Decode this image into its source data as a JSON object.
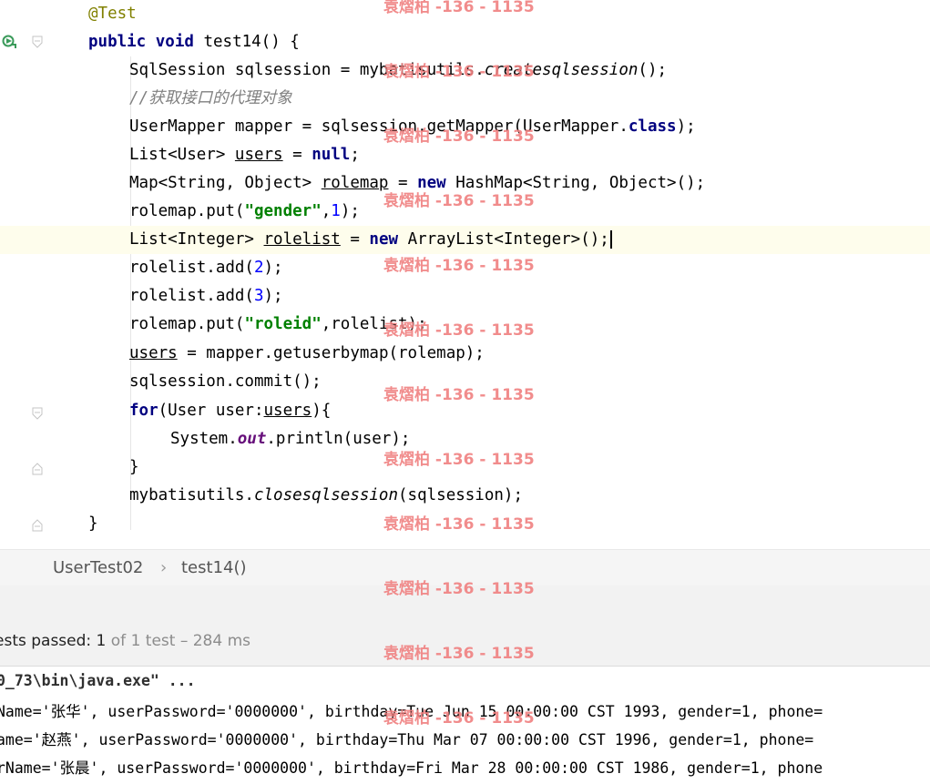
{
  "editor": {
    "lines": [
      {
        "id": "l0"
      },
      {
        "id": "l1"
      }
    ],
    "code": {
      "ann": "@Test",
      "public": "public",
      "void": "void",
      "method_sig": " test14() {",
      "l2_a": "SqlSession sqlsession = mybatisutils.",
      "l2_b": "createsqlsession",
      "l2_c": "();",
      "l3": "//获取接口的代理对象",
      "l4_a": "UserMapper mapper = sqlsession.getMapper(UserMapper.",
      "l4_class": "class",
      "l4_b": ");",
      "l5_a": "List<User> ",
      "l5_users": "users",
      "l5_b": " = ",
      "l5_null": "null",
      "l5_c": ";",
      "l6_a": "Map<String, Object> ",
      "l6_rolemap": "rolemap",
      "l6_b": " = ",
      "l6_new": "new",
      "l6_c": " HashMap<String, Object>();",
      "l7_a": "rolemap.put(",
      "l7_str": "\"gender\"",
      "l7_b": ",",
      "l7_num": "1",
      "l7_c": ");",
      "l8_a": "List<Integer> ",
      "l8_rolelist": "rolelist",
      "l8_b": " = ",
      "l8_new": "new",
      "l8_c": " ArrayList<Integer>();",
      "l9_a": "rolelist.add(",
      "l9_num": "2",
      "l9_b": ");",
      "l10_a": "rolelist.add(",
      "l10_num": "3",
      "l10_b": ");",
      "l11_a": "rolemap.put(",
      "l11_str": "\"roleid\"",
      "l11_b": ",rolelist);",
      "l12_users": "users",
      "l12_b": " = mapper.getuserbymap(rolemap);",
      "l13": "sqlsession.commit();",
      "l14_for": "for",
      "l14_a": "(User user:",
      "l14_users": "users",
      "l14_b": "){",
      "l15_a": "System.",
      "l15_out": "out",
      "l15_b": ".println(user);",
      "l16": "}",
      "l17_a": "mybatisutils.",
      "l17_m": "closesqlsession",
      "l17_b": "(sqlsession);",
      "l18": "}"
    }
  },
  "breadcrumb": {
    "class_name": "UserTest02",
    "separator": "›",
    "method_name": "test14()"
  },
  "test_status": {
    "label": "ests passed: ",
    "passed": "1",
    "rest": " of 1 test – 284 ms"
  },
  "console": {
    "cmd": "0_73\\bin\\java.exe\" ...",
    "rows": [
      "Name='张华', userPassword='0000000', birthday=Tue Jun 15 00:00:00 CST 1993, gender=1, phone=",
      "ame='赵燕', userPassword='0000000', birthday=Thu Mar 07 00:00:00 CST 1996, gender=1, phone=",
      "rName='张晨', userPassword='0000000', birthday=Fri Mar 28 00:00:00 CST 1986, gender=1, phone"
    ]
  },
  "watermark": "袁熠柏 -136 - 1135",
  "colors": {
    "keyword": "#000080",
    "string": "#008000",
    "number": "#0000ff",
    "annotation": "#808000",
    "comment": "#808080",
    "watermark": "#f08080"
  }
}
